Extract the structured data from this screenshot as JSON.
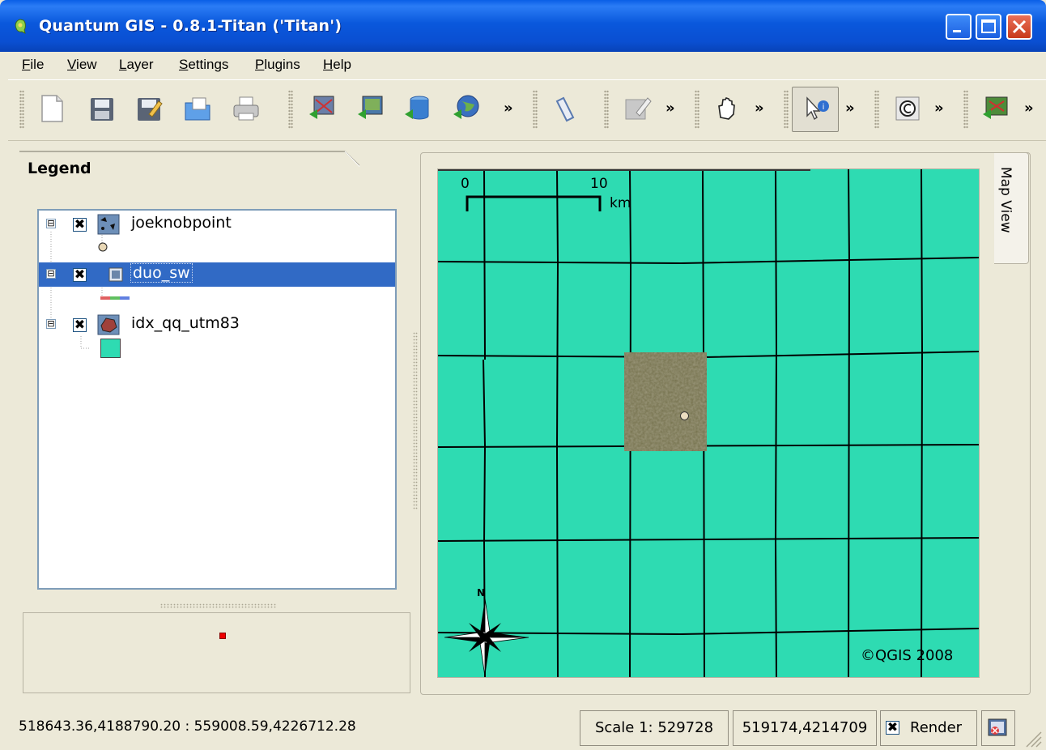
{
  "window": {
    "title": "Quantum GIS - 0.8.1-Titan ('Titan')"
  },
  "menu": [
    {
      "underline": "F",
      "rest": "ile"
    },
    {
      "underline": "V",
      "rest": "iew"
    },
    {
      "underline": "L",
      "rest": "ayer"
    },
    {
      "underline": "S",
      "rest": "ettings"
    },
    {
      "underline": "P",
      "rest": "lugins"
    },
    {
      "underline": "H",
      "rest": "elp"
    }
  ],
  "toolbar": {
    "more_glyph": "»"
  },
  "legend": {
    "title": "Legend",
    "layers": [
      {
        "name": "joeknobpoint",
        "checked": "✖",
        "expander": "⊟"
      },
      {
        "name": "duo_sw",
        "checked": "✖",
        "expander": "⊟"
      },
      {
        "name": "idx_qq_utm83",
        "checked": "✖",
        "expander": "⊟"
      }
    ],
    "layer_fill_color": "#2edbb2"
  },
  "map": {
    "tab_label": "Map View",
    "scalebar": {
      "left": "0",
      "right": "10",
      "unit": "km"
    },
    "north": "N",
    "copyright": "©QGIS 2008",
    "background_color": "#2edbb2"
  },
  "status": {
    "extent": "518643.36,4188790.20 : 559008.59,4226712.28",
    "scale": "Scale 1: 529728",
    "coords": "519174,4214709",
    "render_label": "Render",
    "render_checked": "✖"
  }
}
